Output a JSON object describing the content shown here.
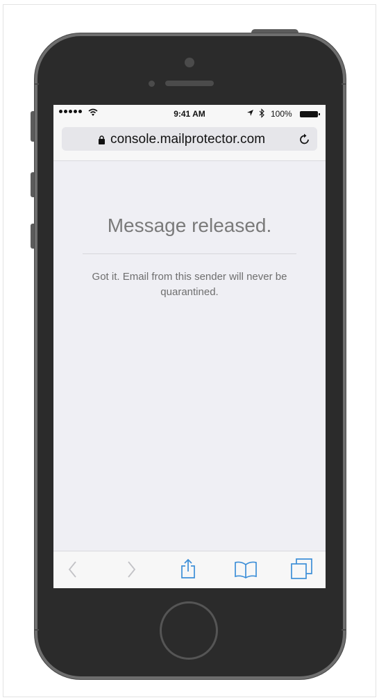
{
  "status_bar": {
    "time": "9:41 AM",
    "battery": "100%"
  },
  "browser": {
    "url": "console.mailprotector.com"
  },
  "page": {
    "title": "Message released.",
    "message": "Got it. Email from this sender will never be quarantined."
  },
  "icons": [
    "signal-dots-icon",
    "wifi-icon",
    "location-arrow-icon",
    "bluetooth-icon",
    "battery-icon",
    "lock-icon",
    "reload-icon",
    "back-icon",
    "forward-icon",
    "share-icon",
    "bookmarks-icon",
    "tabs-icon"
  ],
  "colors": {
    "accent": "#3d8fd8",
    "disabled": "#c2c2c6"
  }
}
